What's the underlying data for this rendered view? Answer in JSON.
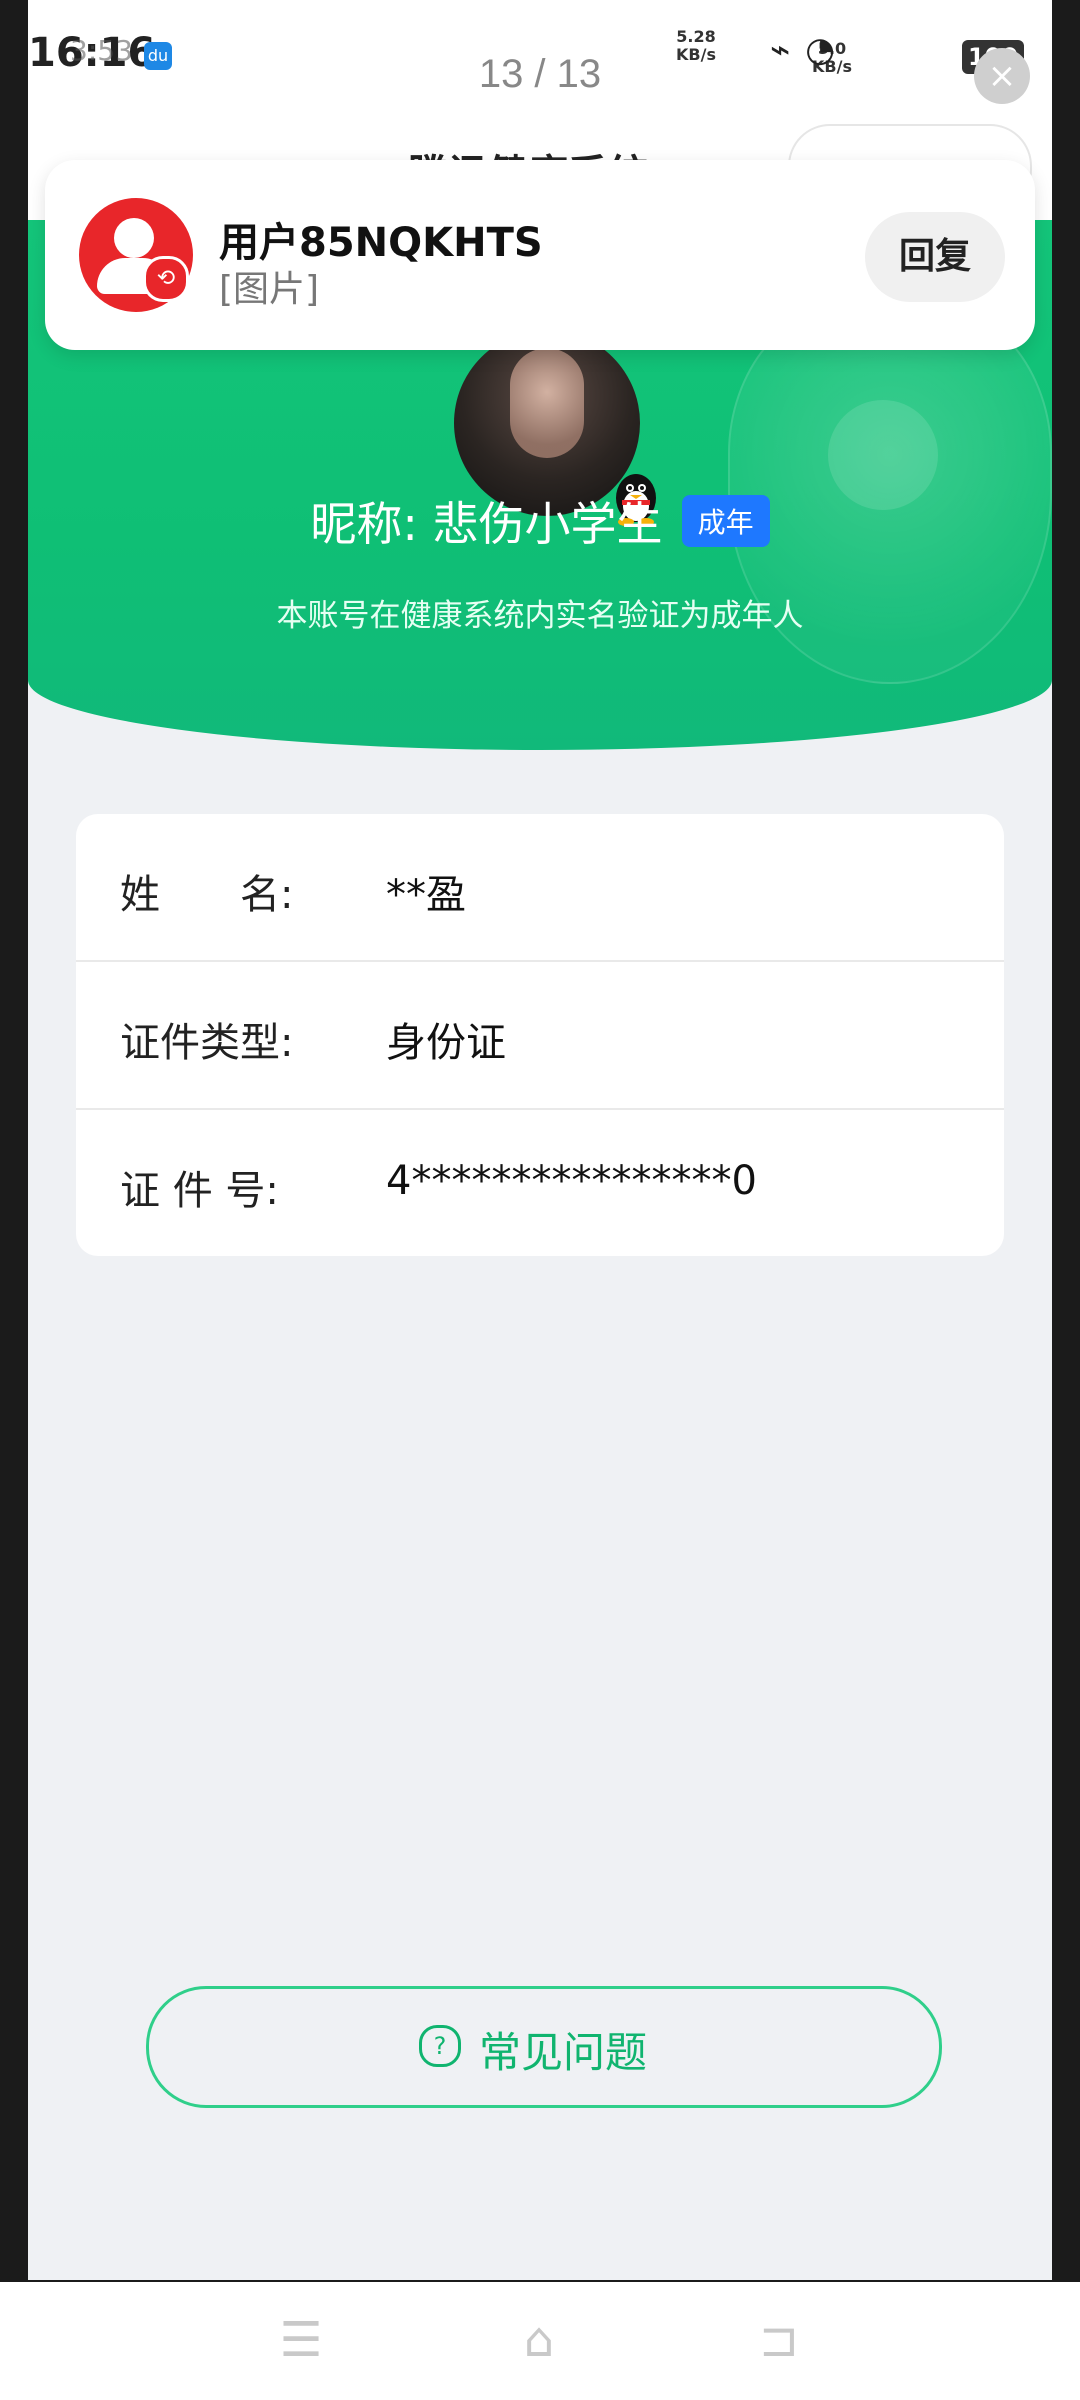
{
  "status_bar": {
    "time": "16:16",
    "time_ghost": "3:53",
    "small_app_icon": "du",
    "net_speed_left": {
      "value": "5.28",
      "unit": "KB/s"
    },
    "net_speed_right": {
      "value": "5.0",
      "unit": "KB/s"
    },
    "battery": "100",
    "icons": [
      "signal-5g-icon",
      "wifi-icon",
      "battery-icon"
    ]
  },
  "viewer": {
    "page_counter": "13 / 13"
  },
  "app_header": {
    "title": "腾讯健康系统"
  },
  "notification": {
    "title": "用户85NQKHTS",
    "subtitle": "[图片]",
    "reply_label": "回复",
    "avatar_color": "#e8262a"
  },
  "profile": {
    "nickname": "昵称: 悲伤小学生",
    "badge": "成年",
    "verify_note": "本账号在健康系统内实名验证为成年人",
    "hero_color": "#14c57a",
    "badge_color": "#1e78ff"
  },
  "info_rows": [
    {
      "label": "姓　　名:",
      "value": "**盈"
    },
    {
      "label": "证件类型:",
      "value": "身份证"
    },
    {
      "label": "证 件 号:",
      "value": "4****************0"
    }
  ],
  "faq": {
    "icon": "?",
    "label": "常见问题",
    "accent": "#10b46f"
  },
  "nav": {
    "icons": [
      "menu-icon",
      "home-icon",
      "back-icon"
    ]
  }
}
